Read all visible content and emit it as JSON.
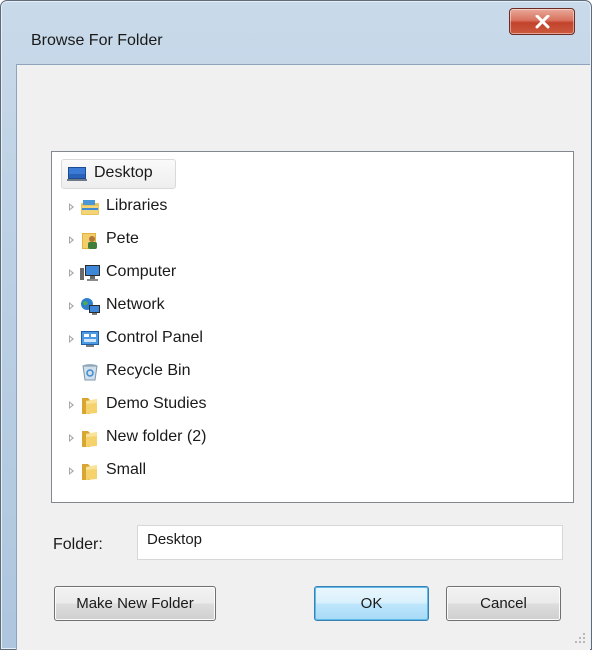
{
  "window": {
    "title": "Browse For Folder",
    "close_icon": "close-icon"
  },
  "tree": {
    "items": [
      {
        "label": "Desktop",
        "icon": "desktop-icon",
        "expander": false,
        "selected": true
      },
      {
        "label": "Libraries",
        "icon": "libraries-icon",
        "expander": true
      },
      {
        "label": "Pete",
        "icon": "user-folder-icon",
        "expander": true
      },
      {
        "label": "Computer",
        "icon": "computer-icon",
        "expander": true
      },
      {
        "label": "Network",
        "icon": "network-icon",
        "expander": true
      },
      {
        "label": "Control Panel",
        "icon": "control-panel-icon",
        "expander": true
      },
      {
        "label": "Recycle Bin",
        "icon": "recycle-bin-icon",
        "expander": false
      },
      {
        "label": "Demo Studies",
        "icon": "folder-icon",
        "expander": true
      },
      {
        "label": "New folder (2)",
        "icon": "folder-icon",
        "expander": true
      },
      {
        "label": "Small",
        "icon": "folder-icon",
        "expander": true
      }
    ]
  },
  "folder": {
    "label": "Folder:",
    "value": "Desktop"
  },
  "buttons": {
    "make_new_folder": "Make New Folder",
    "ok": "OK",
    "cancel": "Cancel"
  }
}
